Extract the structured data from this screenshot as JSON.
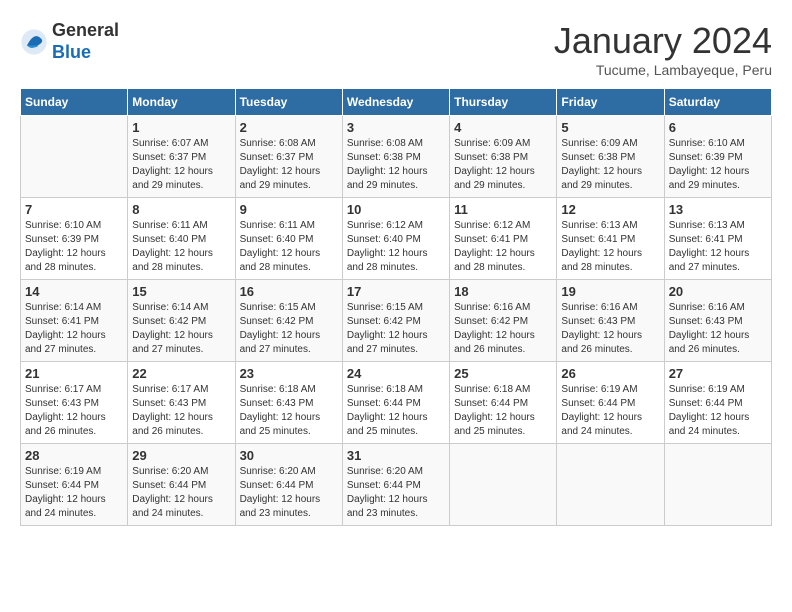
{
  "header": {
    "logo_general": "General",
    "logo_blue": "Blue",
    "month_title": "January 2024",
    "subtitle": "Tucume, Lambayeque, Peru"
  },
  "days_of_week": [
    "Sunday",
    "Monday",
    "Tuesday",
    "Wednesday",
    "Thursday",
    "Friday",
    "Saturday"
  ],
  "weeks": [
    [
      {
        "num": "",
        "info": ""
      },
      {
        "num": "1",
        "info": "Sunrise: 6:07 AM\nSunset: 6:37 PM\nDaylight: 12 hours\nand 29 minutes."
      },
      {
        "num": "2",
        "info": "Sunrise: 6:08 AM\nSunset: 6:37 PM\nDaylight: 12 hours\nand 29 minutes."
      },
      {
        "num": "3",
        "info": "Sunrise: 6:08 AM\nSunset: 6:38 PM\nDaylight: 12 hours\nand 29 minutes."
      },
      {
        "num": "4",
        "info": "Sunrise: 6:09 AM\nSunset: 6:38 PM\nDaylight: 12 hours\nand 29 minutes."
      },
      {
        "num": "5",
        "info": "Sunrise: 6:09 AM\nSunset: 6:38 PM\nDaylight: 12 hours\nand 29 minutes."
      },
      {
        "num": "6",
        "info": "Sunrise: 6:10 AM\nSunset: 6:39 PM\nDaylight: 12 hours\nand 29 minutes."
      }
    ],
    [
      {
        "num": "7",
        "info": "Sunrise: 6:10 AM\nSunset: 6:39 PM\nDaylight: 12 hours\nand 28 minutes."
      },
      {
        "num": "8",
        "info": "Sunrise: 6:11 AM\nSunset: 6:40 PM\nDaylight: 12 hours\nand 28 minutes."
      },
      {
        "num": "9",
        "info": "Sunrise: 6:11 AM\nSunset: 6:40 PM\nDaylight: 12 hours\nand 28 minutes."
      },
      {
        "num": "10",
        "info": "Sunrise: 6:12 AM\nSunset: 6:40 PM\nDaylight: 12 hours\nand 28 minutes."
      },
      {
        "num": "11",
        "info": "Sunrise: 6:12 AM\nSunset: 6:41 PM\nDaylight: 12 hours\nand 28 minutes."
      },
      {
        "num": "12",
        "info": "Sunrise: 6:13 AM\nSunset: 6:41 PM\nDaylight: 12 hours\nand 28 minutes."
      },
      {
        "num": "13",
        "info": "Sunrise: 6:13 AM\nSunset: 6:41 PM\nDaylight: 12 hours\nand 27 minutes."
      }
    ],
    [
      {
        "num": "14",
        "info": "Sunrise: 6:14 AM\nSunset: 6:41 PM\nDaylight: 12 hours\nand 27 minutes."
      },
      {
        "num": "15",
        "info": "Sunrise: 6:14 AM\nSunset: 6:42 PM\nDaylight: 12 hours\nand 27 minutes."
      },
      {
        "num": "16",
        "info": "Sunrise: 6:15 AM\nSunset: 6:42 PM\nDaylight: 12 hours\nand 27 minutes."
      },
      {
        "num": "17",
        "info": "Sunrise: 6:15 AM\nSunset: 6:42 PM\nDaylight: 12 hours\nand 27 minutes."
      },
      {
        "num": "18",
        "info": "Sunrise: 6:16 AM\nSunset: 6:42 PM\nDaylight: 12 hours\nand 26 minutes."
      },
      {
        "num": "19",
        "info": "Sunrise: 6:16 AM\nSunset: 6:43 PM\nDaylight: 12 hours\nand 26 minutes."
      },
      {
        "num": "20",
        "info": "Sunrise: 6:16 AM\nSunset: 6:43 PM\nDaylight: 12 hours\nand 26 minutes."
      }
    ],
    [
      {
        "num": "21",
        "info": "Sunrise: 6:17 AM\nSunset: 6:43 PM\nDaylight: 12 hours\nand 26 minutes."
      },
      {
        "num": "22",
        "info": "Sunrise: 6:17 AM\nSunset: 6:43 PM\nDaylight: 12 hours\nand 26 minutes."
      },
      {
        "num": "23",
        "info": "Sunrise: 6:18 AM\nSunset: 6:43 PM\nDaylight: 12 hours\nand 25 minutes."
      },
      {
        "num": "24",
        "info": "Sunrise: 6:18 AM\nSunset: 6:44 PM\nDaylight: 12 hours\nand 25 minutes."
      },
      {
        "num": "25",
        "info": "Sunrise: 6:18 AM\nSunset: 6:44 PM\nDaylight: 12 hours\nand 25 minutes."
      },
      {
        "num": "26",
        "info": "Sunrise: 6:19 AM\nSunset: 6:44 PM\nDaylight: 12 hours\nand 24 minutes."
      },
      {
        "num": "27",
        "info": "Sunrise: 6:19 AM\nSunset: 6:44 PM\nDaylight: 12 hours\nand 24 minutes."
      }
    ],
    [
      {
        "num": "28",
        "info": "Sunrise: 6:19 AM\nSunset: 6:44 PM\nDaylight: 12 hours\nand 24 minutes."
      },
      {
        "num": "29",
        "info": "Sunrise: 6:20 AM\nSunset: 6:44 PM\nDaylight: 12 hours\nand 24 minutes."
      },
      {
        "num": "30",
        "info": "Sunrise: 6:20 AM\nSunset: 6:44 PM\nDaylight: 12 hours\nand 23 minutes."
      },
      {
        "num": "31",
        "info": "Sunrise: 6:20 AM\nSunset: 6:44 PM\nDaylight: 12 hours\nand 23 minutes."
      },
      {
        "num": "",
        "info": ""
      },
      {
        "num": "",
        "info": ""
      },
      {
        "num": "",
        "info": ""
      }
    ]
  ]
}
